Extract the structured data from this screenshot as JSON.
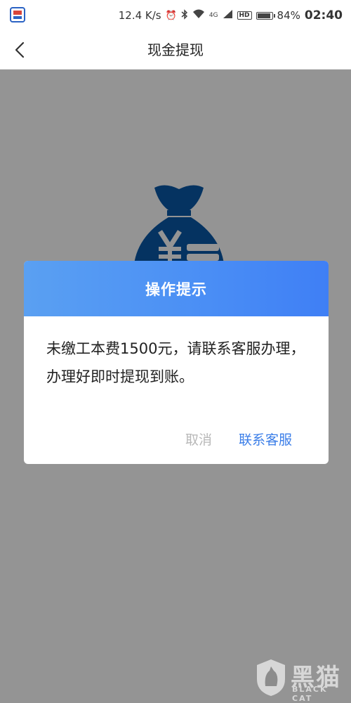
{
  "status_bar": {
    "speed": "12.4 K/s",
    "battery": "84%",
    "time": "02:40",
    "icons": [
      "app-icon",
      "alarm-icon",
      "bluetooth-icon",
      "wifi-icon",
      "4g-icon",
      "signal-icon",
      "hd-icon",
      "battery-icon"
    ],
    "network_label": "4G",
    "hd_label": "HD"
  },
  "nav": {
    "title": "现金提现",
    "back_icon": "chevron-left-icon"
  },
  "content": {
    "illustration": "money-bag-icon",
    "accent_color": "#0a59a8"
  },
  "dialog": {
    "title": "操作提示",
    "message": "未缴工本费1500元，请联系客服办理，办理好即时提现到账。",
    "cancel_label": "取消",
    "contact_label": "联系客服",
    "header_color": "#4a8ef5",
    "cancel_color": "#b8b8b8",
    "contact_color": "#3b7ee8"
  },
  "watermark": {
    "big_text": "黑猫",
    "small_text": "BLACK CAT"
  }
}
